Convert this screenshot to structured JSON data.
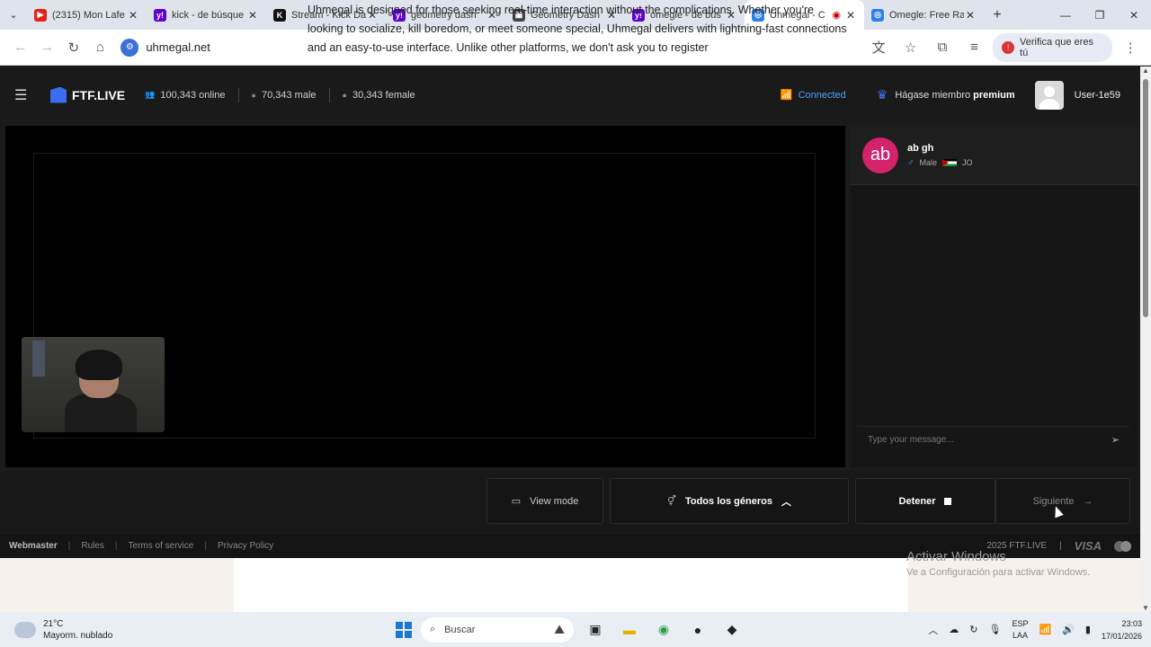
{
  "browser": {
    "tabs": [
      {
        "title": "(2315) Mon Lafe",
        "favicon": "youtube-icon",
        "color": "#e62117",
        "glyph": "▶"
      },
      {
        "title": "kick - de búsque",
        "favicon": "yahoo-icon",
        "color": "#6001d2",
        "glyph": "y!"
      },
      {
        "title": "Stream - Kick Da",
        "favicon": "kick-icon",
        "color": "#111111",
        "glyph": "K"
      },
      {
        "title": "geometry dash",
        "favicon": "yahoo-icon",
        "color": "#6001d2",
        "glyph": "y!"
      },
      {
        "title": "Geometry Dash",
        "favicon": "geometry-dash-icon",
        "color": "#444444",
        "glyph": "▦"
      },
      {
        "title": "omegle - de bús",
        "favicon": "yahoo-icon",
        "color": "#6001d2",
        "glyph": "y!"
      },
      {
        "title": "Uhmegal - C",
        "favicon": "uhmegal-icon",
        "color": "#2f80ed",
        "glyph": "◎",
        "active": true
      },
      {
        "title": "Omegle: Free Ra",
        "favicon": "omegle-icon",
        "color": "#2f80ed",
        "glyph": "◎"
      }
    ],
    "url": "uhmegal.net",
    "verify_label": "Verifica que eres tú"
  },
  "site": {
    "logo": "FTF.LIVE",
    "online": "100,343 online",
    "male": "70,343 male",
    "female": "30,343 female",
    "connected": "Connected",
    "premium_prefix": "Hágase miembro",
    "premium_bold": "premium",
    "username": "User-1e59"
  },
  "chat": {
    "partner_initials": "ab",
    "partner_name": "ab gh",
    "partner_gender": "Male",
    "partner_country": "JO",
    "input_placeholder": "Type your message..."
  },
  "controls": {
    "view_mode": "View mode",
    "genders": "Todos los géneros",
    "stop": "Detener",
    "next": "Siguiente"
  },
  "footer": {
    "webmaster": "Webmaster",
    "rules": "Rules",
    "terms": "Terms of service",
    "privacy": "Privacy Policy",
    "copyright": "2025 FTF.LIVE",
    "visa": "VISA"
  },
  "below": {
    "text": "Uhmegal is designed for those seeking real-time interaction without the complications. Whether you're looking to socialize, kill boredom, or meet someone special, Uhmegal delivers with lightning-fast connections and an easy-to-use interface. Unlike other platforms, we don't ask you to register"
  },
  "watermark": {
    "line1": "Activar Windows",
    "line2": "Ve a Configuración para activar Windows."
  },
  "taskbar": {
    "temp": "21°C",
    "weather": "Mayorm. nublado",
    "search": "Buscar",
    "lang1": "ESP",
    "lang2": "LAA",
    "time": "23:03",
    "date": "17/01/2026"
  }
}
